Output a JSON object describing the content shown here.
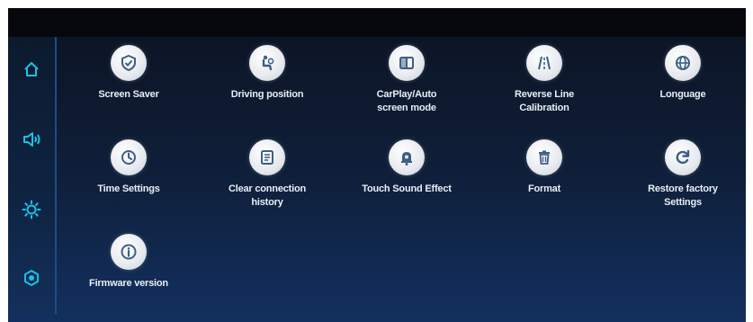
{
  "sidebar": {
    "items": [
      {
        "icon": "home-icon"
      },
      {
        "icon": "speaker-icon"
      },
      {
        "icon": "brightness-icon"
      },
      {
        "icon": "settings-icon"
      }
    ]
  },
  "settings": {
    "items": [
      {
        "label": "Screen Saver",
        "icon": "shield-check-icon"
      },
      {
        "label": "Driving position",
        "icon": "driver-seat-icon"
      },
      {
        "label": "CarPlay/Auto\nscreen mode",
        "icon": "split-screen-icon"
      },
      {
        "label": "Reverse Line\nCalibration",
        "icon": "road-lines-icon"
      },
      {
        "label": "Longuage",
        "icon": "globe-icon"
      },
      {
        "label": "Time Settings",
        "icon": "clock-icon"
      },
      {
        "label": "Clear connection\nhistory",
        "icon": "document-icon"
      },
      {
        "label": "Touch Sound Effect",
        "icon": "bell-icon"
      },
      {
        "label": "Format",
        "icon": "trash-icon"
      },
      {
        "label": "Restore factory\nSettings",
        "icon": "refresh-icon"
      },
      {
        "label": "Firmware version",
        "icon": "info-icon"
      }
    ]
  },
  "colors": {
    "accent": "#19c2e6",
    "icon_fill": "#3d5f86",
    "label_text": "#e8eef6"
  }
}
